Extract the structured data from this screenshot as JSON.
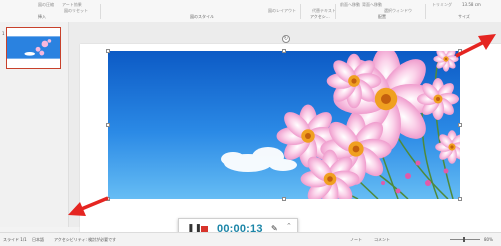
{
  "ribbon": {
    "group_labels": [
      "挿入",
      "図のスタイル",
      "アクセシ…",
      "配置",
      "サイズ"
    ],
    "faint_items": [
      "図の圧縮",
      "アート効果",
      "図のリセット",
      "図のレイアウト",
      "代替テキスト",
      "前面へ移動",
      "背面へ移動",
      "選択ウィンドウ",
      "トリミング"
    ],
    "size_value": "13.58 cm"
  },
  "sidebar": {
    "slide_number": "1"
  },
  "recording_toolbar": {
    "time": "00:00:13",
    "pause_symbol": "❚❚",
    "pen_symbol": "✎",
    "more_symbol": "⌃"
  },
  "status_bar": {
    "slide_info": "スライド 1/1",
    "language": "日本語",
    "accessibility": "アクセシビリティ: 検討が必要です",
    "notes": "ノート",
    "comments": "コメント",
    "zoom": "80%"
  },
  "colors": {
    "arrow": "#e52521",
    "timer": "#1c86a8",
    "stop": "#d8342b",
    "sky_top": "#0d5fc8",
    "sky_bottom": "#5fb6f2",
    "flower": "#f7b8dd",
    "flower_center": "#f0a020"
  },
  "icons": [
    "pause-icon",
    "stop-icon",
    "pen-icon",
    "chevron-up-icon",
    "rotate-handle-icon",
    "arrow-icon"
  ]
}
